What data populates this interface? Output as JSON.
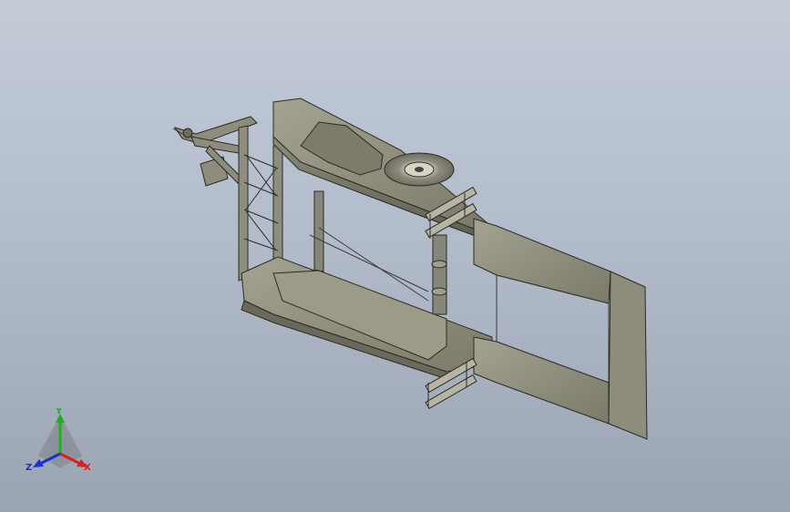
{
  "viewport": {
    "background_top": "#c4ccd8",
    "background_bottom": "#9aa4b3"
  },
  "model": {
    "body_color": "#8b8a78",
    "body_dark": "#6c6b5c",
    "body_light": "#a5a491",
    "edge_color": "#2b2b26"
  },
  "triad": {
    "x_label": "X",
    "y_label": "Y",
    "z_label": "Z",
    "x_color": "#d81e1e",
    "y_color": "#1fb01f",
    "z_color": "#1a2fd6"
  }
}
